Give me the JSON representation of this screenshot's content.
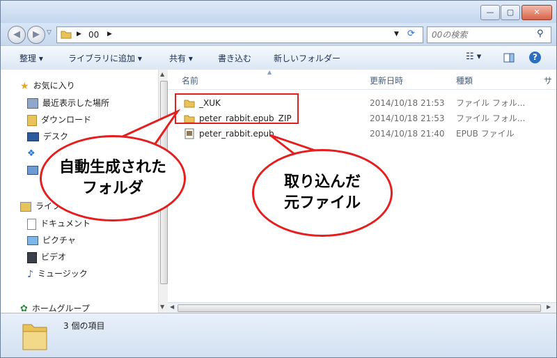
{
  "window": {
    "controls": {
      "minimize": "—",
      "maximize": "▢",
      "close": "✕"
    }
  },
  "address": {
    "path": "00",
    "search_placeholder": "00の検索"
  },
  "toolbar": {
    "organize": "整理 ▾",
    "add_library": "ライブラリに追加 ▾",
    "share": "共有 ▾",
    "burn": "書き込む",
    "new_folder": "新しいフォルダー"
  },
  "nav": {
    "favorites": {
      "label": "お気に入り",
      "items": [
        {
          "label": "最近表示した場所",
          "icon": "recent-places-icon"
        },
        {
          "label": "ダウンロード",
          "icon": "downloads-icon"
        },
        {
          "label": "デスク",
          "icon": "desktop-icon"
        },
        {
          "label": "",
          "icon": "dropbox-icon"
        },
        {
          "label": "",
          "icon": "computer-icon"
        }
      ]
    },
    "libraries": {
      "label": "ライブラリ",
      "items": [
        {
          "label": "ドキュメント",
          "icon": "documents-icon"
        },
        {
          "label": "ピクチャ",
          "icon": "pictures-icon"
        },
        {
          "label": "ビデオ",
          "icon": "videos-icon"
        },
        {
          "label": "ミュージック",
          "icon": "music-icon"
        }
      ]
    },
    "homegroup": {
      "label": "ホームグループ"
    }
  },
  "columns": [
    "名前",
    "更新日時",
    "種類",
    "サ"
  ],
  "files": [
    {
      "name": "_XUK",
      "date": "2014/10/18 21:53",
      "type": "ファイル フォル...",
      "icon": "folder-icon"
    },
    {
      "name": "peter_rabbit.epub_ZIP",
      "date": "2014/10/18 21:53",
      "type": "ファイル フォル...",
      "icon": "folder-icon"
    },
    {
      "name": "peter_rabbit.epub",
      "date": "2014/10/18 21:40",
      "type": "EPUB ファイル",
      "icon": "epub-file-icon"
    }
  ],
  "status": {
    "count_text": "3 個の項目"
  },
  "annotations": {
    "auto_folder": {
      "line1": "自動生成された",
      "line2": "フォルダ"
    },
    "source_file": {
      "line1": "取り込んだ",
      "line2": "元ファイル"
    }
  },
  "colors": {
    "annotation_red": "#e41f1f",
    "folder_yellow": "#e8c35a"
  }
}
